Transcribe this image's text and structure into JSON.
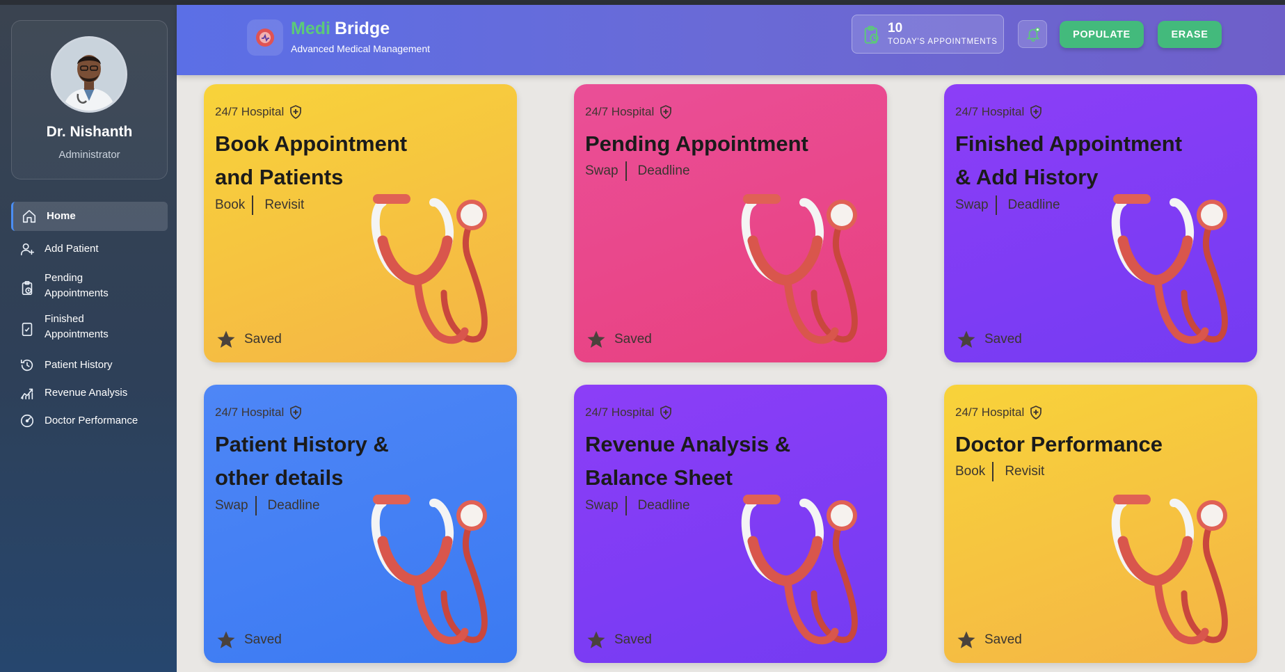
{
  "colors": {
    "accent_green": "#43ba7c",
    "brand_green": "#5cc97a",
    "nav_active_bar": "#4b8ef3",
    "card_yellow": "#f8d33a",
    "card_pink": "#ea4f97",
    "card_purple": "#8c3ef7",
    "card_blue": "#4e86f6"
  },
  "profile": {
    "name": "Dr. Nishanth",
    "role": "Administrator"
  },
  "nav": [
    {
      "label": "Home",
      "icon": "home-icon",
      "active": true
    },
    {
      "label": "Add Patient",
      "icon": "user-plus-icon"
    },
    {
      "label": "Pending Appointments",
      "icon": "clipboard-clock-icon"
    },
    {
      "label": "Finished Appointments",
      "icon": "clipboard-check-icon"
    },
    {
      "label": "Patient History",
      "icon": "history-icon"
    },
    {
      "label": "Revenue Analysis",
      "icon": "chart-line-icon"
    },
    {
      "label": "Doctor Performance",
      "icon": "gauge-icon"
    }
  ],
  "header": {
    "brand_medi": "Medi",
    "brand_bridge": "Bridge",
    "brand_sub": "Advanced Medical Management",
    "appointments_count": "10",
    "appointments_label": "TODAY'S APPOINTMENTS",
    "populate_label": "POPULATE",
    "erase_label": "ERASE"
  },
  "cards": [
    {
      "tag": "24/7 Hospital",
      "title": "Book Appointment and Patients",
      "link1": "Book",
      "link2": "Revisit",
      "saved": "Saved",
      "color": "yellow"
    },
    {
      "tag": "24/7 Hospital",
      "title": "Pending Appointment",
      "link1": "Swap",
      "link2": "Deadline",
      "saved": "Saved",
      "color": "pink"
    },
    {
      "tag": "24/7 Hospital",
      "title": "Finished Appointment & Add History",
      "link1": "Swap",
      "link2": "Deadline",
      "saved": "Saved",
      "color": "purple"
    },
    {
      "tag": "24/7 Hospital",
      "title": "Patient History & other details",
      "link1": "Swap",
      "link2": "Deadline",
      "saved": "Saved",
      "color": "blue"
    },
    {
      "tag": "24/7 Hospital",
      "title": "Revenue Analysis & Balance Sheet",
      "link1": "Swap",
      "link2": "Deadline",
      "saved": "Saved",
      "color": "purple"
    },
    {
      "tag": "24/7 Hospital",
      "title": "Doctor Performance",
      "link1": "Book",
      "link2": "Revisit",
      "saved": "Saved",
      "color": "yellow"
    }
  ]
}
